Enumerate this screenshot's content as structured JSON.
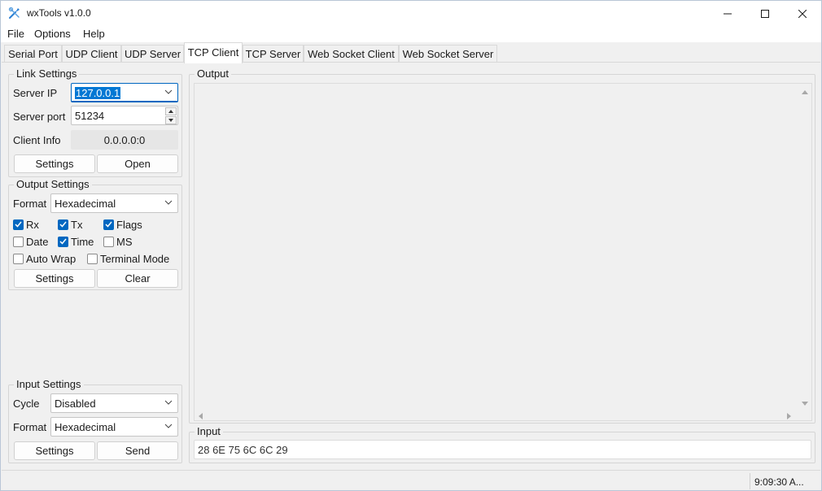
{
  "window": {
    "title": "wxTools v1.0.0"
  },
  "menu": {
    "items": [
      "File",
      "Options",
      "Help"
    ]
  },
  "tabs": [
    "Serial Port",
    "UDP Client",
    "UDP Server",
    "TCP Client",
    "TCP Server",
    "Web Socket Client",
    "Web Socket Server"
  ],
  "active_tab": "TCP Client",
  "link_settings": {
    "title": "Link Settings",
    "server_ip_label": "Server IP",
    "server_ip_value": "127.0.0.1",
    "server_port_label": "Server port",
    "server_port_value": "51234",
    "client_info_label": "Client Info",
    "client_info_value": "0.0.0.0:0",
    "settings_button": "Settings",
    "open_button": "Open"
  },
  "output_settings": {
    "title": "Output Settings",
    "format_label": "Format",
    "format_value": "Hexadecimal",
    "checkboxes": [
      {
        "label": "Rx",
        "checked": true
      },
      {
        "label": "Tx",
        "checked": true
      },
      {
        "label": "Flags",
        "checked": true
      },
      {
        "label": "Date",
        "checked": false
      },
      {
        "label": "Time",
        "checked": true
      },
      {
        "label": "MS",
        "checked": false
      },
      {
        "label": "Auto Wrap",
        "checked": false
      },
      {
        "label": "Terminal Mode",
        "checked": false
      }
    ],
    "settings_button": "Settings",
    "clear_button": "Clear"
  },
  "input_settings": {
    "title": "Input Settings",
    "cycle_label": "Cycle",
    "cycle_value": "Disabled",
    "format_label": "Format",
    "format_value": "Hexadecimal",
    "settings_button": "Settings",
    "send_button": "Send"
  },
  "output_panel": {
    "title": "Output"
  },
  "input_panel": {
    "title": "Input",
    "value": "28 6E 75 6C 6C 29"
  },
  "status": {
    "time": "9:09:30 A..."
  },
  "colors": {
    "accent": "#0067c0",
    "selection": "#0078d4"
  }
}
